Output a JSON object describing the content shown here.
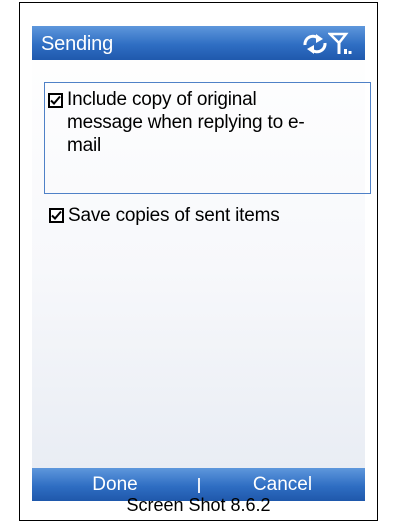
{
  "header": {
    "title": "Sending",
    "icons": [
      "sync-icon",
      "signal-icon"
    ]
  },
  "options": [
    {
      "label_lines": [
        "Include copy of original",
        "message when replying to e-",
        "mail"
      ],
      "checked": true,
      "focused": true
    },
    {
      "label": "Save copies of sent items",
      "checked": true,
      "focused": false
    }
  ],
  "softkeys": {
    "left": "Done",
    "right": "Cancel"
  },
  "caption": "Screen Shot 8.6.2",
  "colors": {
    "titlebar": "#2f6ec3",
    "focus_border": "#4f81c7"
  }
}
